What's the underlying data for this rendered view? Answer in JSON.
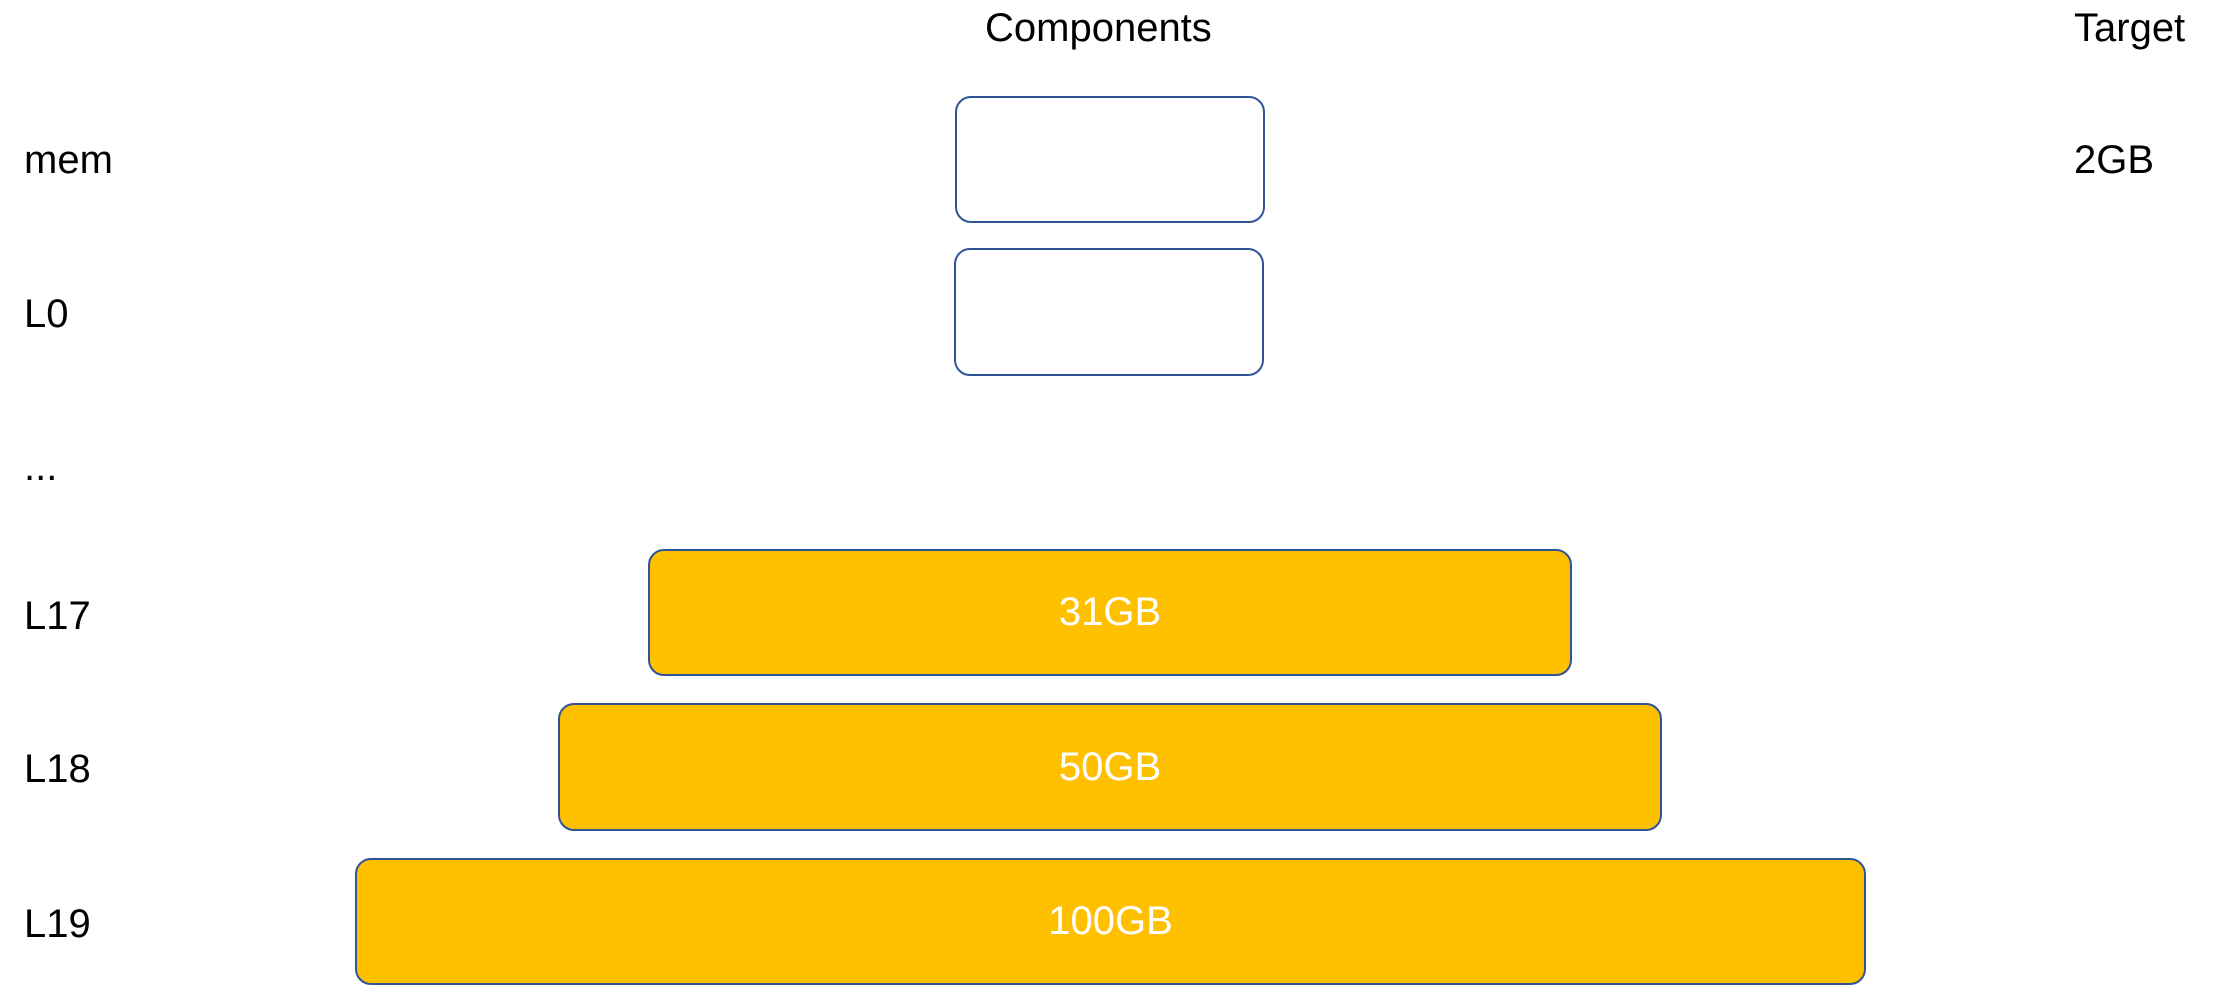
{
  "headers": {
    "components": "Components",
    "target": "Target"
  },
  "levels": [
    {
      "label": "mem",
      "size": "",
      "target": "2GB",
      "filled": false
    },
    {
      "label": "L0",
      "size": "",
      "target": "",
      "filled": false
    },
    {
      "label": "...",
      "size": "",
      "target": "",
      "filled": false
    },
    {
      "label": "L17",
      "size": "31GB",
      "target": "",
      "filled": true
    },
    {
      "label": "L18",
      "size": "50GB",
      "target": "",
      "filled": true
    },
    {
      "label": "L19",
      "size": "100GB",
      "target": "",
      "filled": true
    }
  ],
  "colors": {
    "box_fill": "#ffc000",
    "box_border": "#2f5597",
    "box_text": "#ffffff",
    "text": "#000000"
  }
}
